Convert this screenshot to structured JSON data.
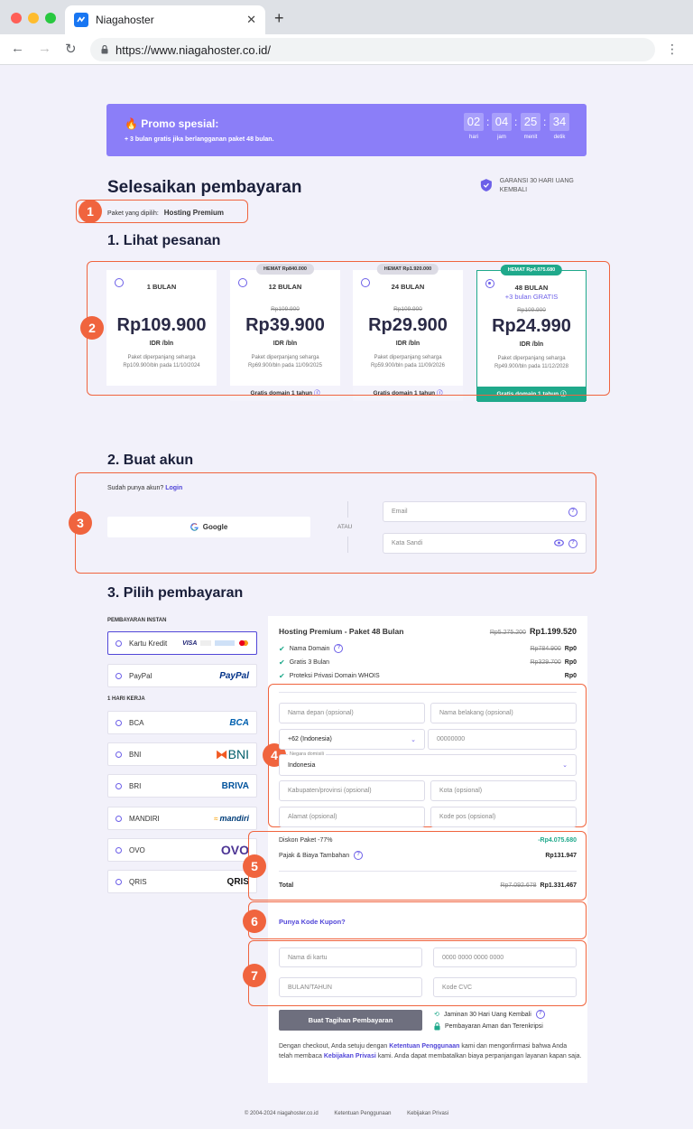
{
  "browser": {
    "tab_title": "Niagahoster",
    "url": "https://www.niagahoster.co.id/"
  },
  "promo": {
    "title": "Promo spesial:",
    "subtitle": "+ 3 bulan gratis jika berlangganan paket 48 bulan.",
    "countdown": [
      {
        "value": "02",
        "label": "hari"
      },
      {
        "value": "04",
        "label": "jam"
      },
      {
        "value": "25",
        "label": "menit"
      },
      {
        "value": "34",
        "label": "detik"
      }
    ]
  },
  "header": {
    "title": "Selesaikan pembayaran",
    "guarantee": "GARANSI 30 HARI UANG KEMBALI",
    "selected_label": "Paket yang dipilih:",
    "selected_value": "Hosting Premium"
  },
  "sections": {
    "order": "1. Lihat pesanan",
    "account": "2. Buat akun",
    "payment": "3. Pilih pembayaran"
  },
  "markers": [
    "1",
    "2",
    "3",
    "4",
    "5",
    "6",
    "7"
  ],
  "plans": [
    {
      "term": "1 BULAN",
      "save": "",
      "original": "",
      "bonus": "",
      "price": "Rp109.900",
      "unit": "IDR /bln",
      "renew_1": "Paket diperpanjang seharga",
      "renew_2": "Rp109.900/bln pada 11/10/2024",
      "gift": ""
    },
    {
      "term": "12 BULAN",
      "save": "HEMAT Rp840.000",
      "original": "Rp109.900",
      "bonus": "",
      "price": "Rp39.900",
      "unit": "IDR /bln",
      "renew_1": "Paket diperpanjang seharga",
      "renew_2": "Rp69.900/bln pada 11/09/2025",
      "gift": "Gratis domain 1 tahun"
    },
    {
      "term": "24 BULAN",
      "save": "HEMAT Rp1.920.000",
      "original": "Rp109.900",
      "bonus": "",
      "price": "Rp29.900",
      "unit": "IDR /bln",
      "renew_1": "Paket diperpanjang seharga",
      "renew_2": "Rp59.900/bln pada 11/09/2026",
      "gift": "Gratis domain 1 tahun"
    },
    {
      "term": "48 BULAN",
      "save": "HEMAT Rp4.075.680",
      "original": "Rp109.900",
      "bonus": "+3 bulan GRATIS",
      "price": "Rp24.990",
      "unit": "IDR /bln",
      "renew_1": "Paket diperpanjang seharga",
      "renew_2": "Rp49.900/bln pada 11/12/2028",
      "gift": "Gratis domain 1 tahun"
    }
  ],
  "account": {
    "question": "Sudah punya akun?",
    "login": "Login",
    "google": "Google",
    "or": "ATAU",
    "email_placeholder": "Email",
    "password_placeholder": "Kata Sandi"
  },
  "payment": {
    "instant_heading": "PEMBAYARAN INSTAN",
    "workday_heading": "1 HARI KERJA",
    "methods": [
      {
        "name": "Kartu Kredit",
        "logo": "VISA"
      },
      {
        "name": "PayPal",
        "logo": "PayPal"
      },
      {
        "name": "BCA",
        "logo": "BCA"
      },
      {
        "name": "BNI",
        "logo": "BNI"
      },
      {
        "name": "BRI",
        "logo": "BRIVA"
      },
      {
        "name": "MANDIRI",
        "logo": "mandiri"
      },
      {
        "name": "OVO",
        "logo": "OVO"
      },
      {
        "name": "QRIS",
        "logo": "QRIS"
      }
    ]
  },
  "summary": {
    "product": "Hosting Premium - Paket 48 Bulan",
    "product_original": "Rp5.275.200",
    "product_price": "Rp1.199.520",
    "items": [
      {
        "label": "Nama Domain",
        "original": "Rp784.900",
        "price": "Rp0"
      },
      {
        "label": "Gratis 3 Bulan",
        "original": "Rp329.700",
        "price": "Rp0"
      },
      {
        "label": "Proteksi Privasi Domain WHOIS",
        "original": "",
        "price": "Rp0"
      }
    ],
    "form": {
      "first_name": "Nama depan (opsional)",
      "last_name": "Nama belakang (opsional)",
      "phone_code": "+62 (Indonesia)",
      "phone": "00000000",
      "country_label": "Negara domisili",
      "country": "Indonesia",
      "province": "Kabupaten/provinsi (opsional)",
      "city": "Kota (opsional)",
      "address": "Alamat (opsional)",
      "postcode": "Kode pos (opsional)"
    },
    "discount_label": "Diskon Paket -77%",
    "discount_value": "-Rp4.075.680",
    "tax_label": "Pajak & Biaya Tambahan",
    "tax_value": "Rp131.947",
    "total_label": "Total",
    "total_original": "Rp7.092.678",
    "total_value": "Rp1.331.467",
    "coupon": "Punya Kode Kupon?",
    "card": {
      "name": "Nama di kartu",
      "number": "0000 0000 0000 0000",
      "expiry": "BULAN/TAHUN",
      "cvc": "Kode CVC"
    },
    "submit": "Buat Tagihan Pembayaran",
    "trust_1": "Jaminan 30 Hari Uang Kembali",
    "trust_2": "Pembayaran Aman dan Terenkripsi",
    "legal_1": "Dengan checkout, Anda setuju dengan",
    "legal_terms": "Ketentuan Penggunaan",
    "legal_2": "kami dan mengonfirmasi bahwa Anda telah membaca",
    "legal_privacy": "Kebijakan Privasi",
    "legal_3": "kami. Anda dapat membatalkan biaya perpanjangan layanan kapan saja."
  },
  "footer": {
    "copyright": "© 2004-2024 niagahoster.co.id",
    "terms": "Ketentuan Penggunaan",
    "privacy": "Kebijakan Privasi"
  },
  "colors": {
    "primary": "#6c5fe8",
    "promo": "#8b7ef8",
    "accent_green": "#1fa98b",
    "marker": "#f0643e"
  }
}
